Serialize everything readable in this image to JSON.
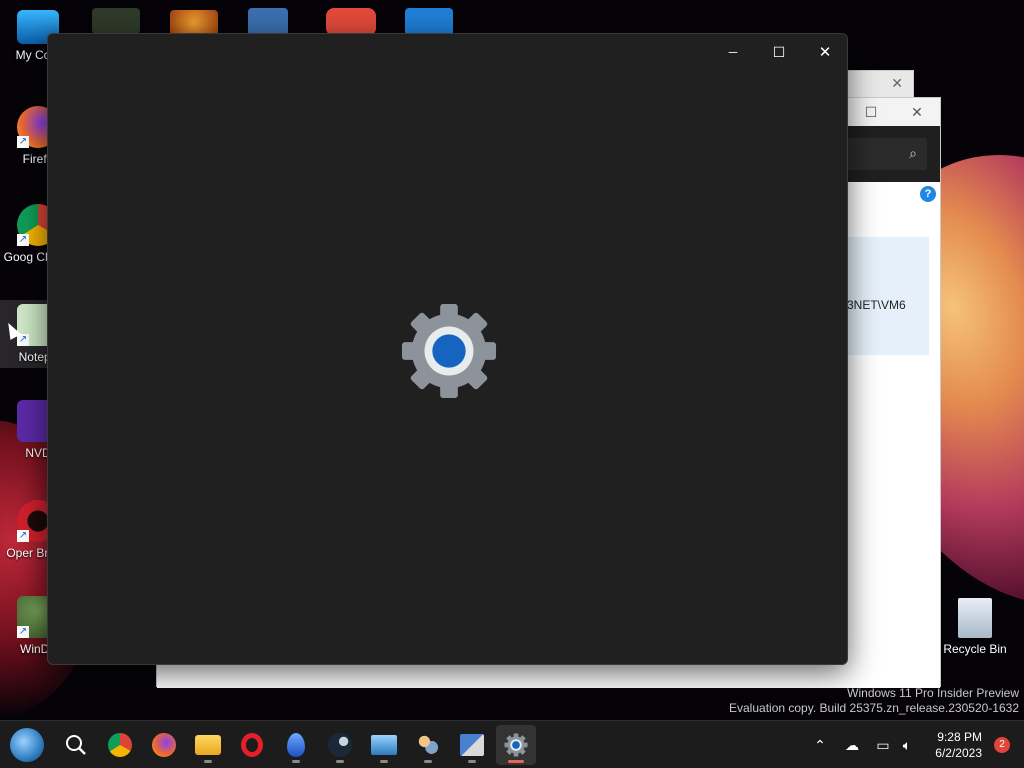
{
  "desktop": {
    "icons": [
      {
        "label": "My Com",
        "icon": "monitor-icon"
      },
      {
        "label": "Firefo",
        "icon": "firefox-icon"
      },
      {
        "label": "Goog Chrom",
        "icon": "chrome-icon"
      },
      {
        "label": "Notepa",
        "icon": "notepad-icon"
      },
      {
        "label": "NVD",
        "icon": "nvda-icon"
      },
      {
        "label": "Oper Brows",
        "icon": "opera-icon"
      },
      {
        "label": "WinDir",
        "icon": "windirstat-icon"
      }
    ],
    "recycle_bin_label": "Recycle Bin"
  },
  "background_window": {
    "path_text": "3NET\\VM6",
    "help_glyph": "?"
  },
  "main_window": {
    "minimize_glyph": "─",
    "maximize_glyph": "☐",
    "close_glyph": "✕",
    "splash_icon": "settings-gear-icon"
  },
  "watermark": {
    "line1": "Windows 11 Pro Insider Preview",
    "line2": "Evaluation copy. Build 25375.zn_release.230520-1632"
  },
  "taskbar": {
    "items": [
      {
        "name": "start",
        "icon": "start-globe-icon"
      },
      {
        "name": "search",
        "icon": "search-icon"
      },
      {
        "name": "chrome",
        "icon": "chrome-icon"
      },
      {
        "name": "firefox",
        "icon": "firefox-icon"
      },
      {
        "name": "file-explorer",
        "icon": "folder-icon"
      },
      {
        "name": "opera",
        "icon": "opera-icon"
      },
      {
        "name": "edge-dev",
        "icon": "drop-icon"
      },
      {
        "name": "steam",
        "icon": "steam-icon"
      },
      {
        "name": "remote-desktop",
        "icon": "remote-desktop-icon"
      },
      {
        "name": "users",
        "icon": "users-icon"
      },
      {
        "name": "network",
        "icon": "network-computer-icon"
      },
      {
        "name": "settings",
        "icon": "settings-gear-icon",
        "active": true
      }
    ],
    "time": "9:28 PM",
    "date": "6/2/2023",
    "notification_count": "2"
  },
  "colors": {
    "window_bg": "#202020",
    "gear_gray": "#8a9099",
    "gear_blue": "#1565c0",
    "taskbar_bg": "#1c1c1c"
  }
}
